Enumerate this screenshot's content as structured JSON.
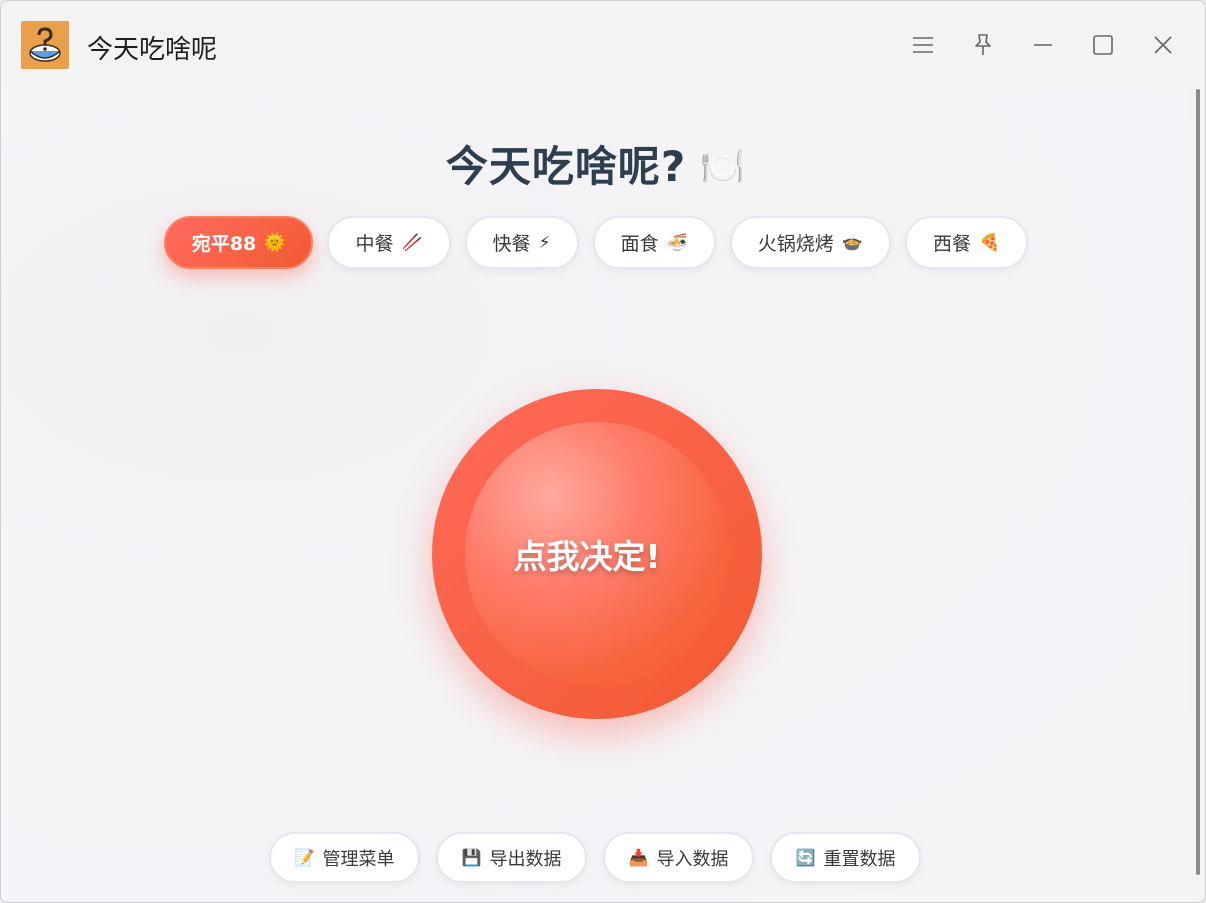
{
  "window": {
    "title": "今天吃啥呢",
    "app_icon": "question-bowl-icon"
  },
  "controls": [
    "menu-icon",
    "pin-icon",
    "minimize-icon",
    "maximize-icon",
    "close-icon"
  ],
  "headline": {
    "text": "今天吃啥呢?",
    "emoji": "🍽️"
  },
  "categories": [
    {
      "label": "宛平88",
      "emoji": "🌞",
      "active": true
    },
    {
      "label": "中餐",
      "emoji": "🥢",
      "active": false
    },
    {
      "label": "快餐",
      "emoji": "⚡",
      "active": false
    },
    {
      "label": "面食",
      "emoji": "🍜",
      "active": false
    },
    {
      "label": "火锅烧烤",
      "emoji": "🍲",
      "active": false
    },
    {
      "label": "西餐",
      "emoji": "🍕",
      "active": false
    }
  ],
  "decide_button": {
    "label": "点我决定!"
  },
  "actions": [
    {
      "label": "管理菜单",
      "emoji": "📝"
    },
    {
      "label": "导出数据",
      "emoji": "💾"
    },
    {
      "label": "导入数据",
      "emoji": "📥"
    },
    {
      "label": "重置数据",
      "emoji": "🔄"
    }
  ],
  "colors": {
    "accent": "#f25a30",
    "accent_light": "#ff6b5e",
    "headline": "#2c3e50"
  }
}
